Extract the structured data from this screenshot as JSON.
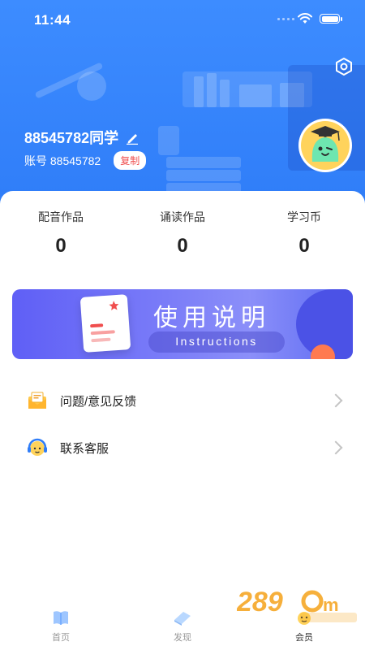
{
  "status_bar": {
    "time": "11:44"
  },
  "profile": {
    "username": "88545782同学",
    "account_label": "账号 88545782",
    "copy_label": "复制"
  },
  "stats": [
    {
      "label": "配音作品",
      "value": "0"
    },
    {
      "label": "诵读作品",
      "value": "0"
    },
    {
      "label": "学习币",
      "value": "0"
    }
  ],
  "banner": {
    "title": "使用说明",
    "subtitle": "Instructions"
  },
  "menu": [
    {
      "label": "问题/意见反馈",
      "icon": "feedback-envelope-icon"
    },
    {
      "label": "联系客服",
      "icon": "customer-service-icon"
    }
  ],
  "tabs": [
    {
      "label": "首页",
      "icon": "book-icon",
      "active": false
    },
    {
      "label": "发现",
      "icon": "discover-icon",
      "active": false
    },
    {
      "label": "会员",
      "icon": "member-icon",
      "active": true
    }
  ],
  "colors": {
    "primary": "#2f7df8",
    "copy_red": "#f04e4e",
    "banner": "#6b6ef7"
  }
}
